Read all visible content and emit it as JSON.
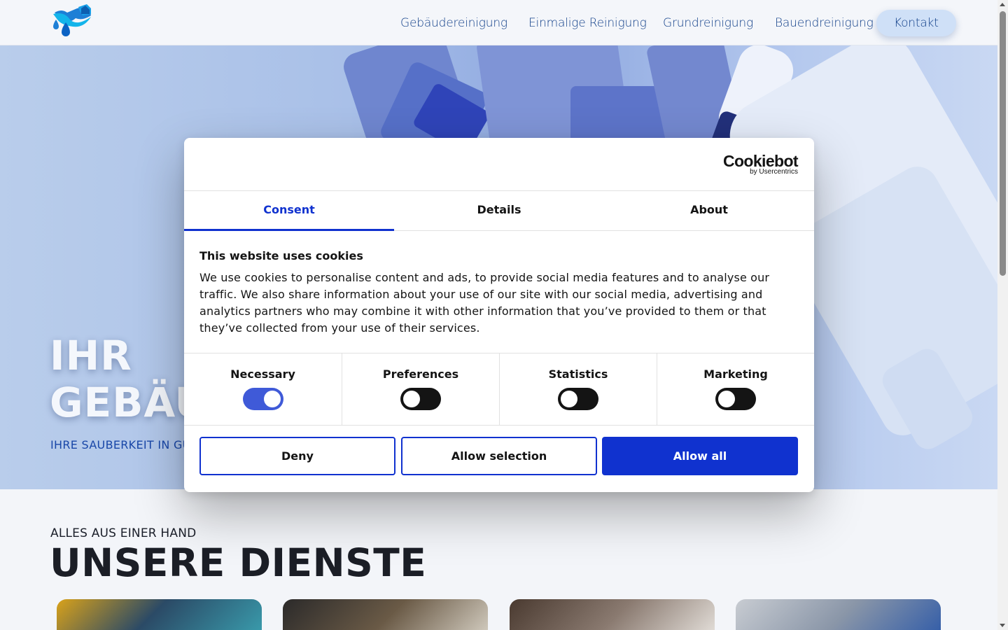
{
  "header": {
    "nav": [
      {
        "label": "Gebäudereinigung"
      },
      {
        "label": "Einmalige Reinigung"
      },
      {
        "label": "Grundreinigung"
      },
      {
        "label": "Bauendreinigung"
      },
      {
        "label": "Kontakt"
      }
    ],
    "logo_icon": "house-water-drop-logo"
  },
  "hero": {
    "title_line1": "IHR",
    "title_line2": "GEBÄU",
    "subtitle": "IHRE SAUBERKEIT IN GU"
  },
  "services": {
    "kicker": "ALLES AUS EINER HAND",
    "title": "UNSERE DIENSTE"
  },
  "cookie_dialog": {
    "brand": "Cookiebot",
    "brand_sub": "by Usercentrics",
    "tabs": [
      {
        "label": "Consent",
        "active": true
      },
      {
        "label": "Details",
        "active": false
      },
      {
        "label": "About",
        "active": false
      }
    ],
    "heading": "This website uses cookies",
    "body": "We use cookies to personalise content and ads, to provide social media features and to analyse our traffic. We also share information about your use of our site with our social media, advertising and analytics partners who may combine it with other information that you’ve provided to them or that they’ve collected from your use of their services.",
    "toggles": [
      {
        "label": "Necessary",
        "checked": true
      },
      {
        "label": "Preferences",
        "checked": false
      },
      {
        "label": "Statistics",
        "checked": false
      },
      {
        "label": "Marketing",
        "checked": false
      }
    ],
    "buttons": {
      "deny": "Deny",
      "allow_selection": "Allow selection",
      "allow_all": "Allow all"
    }
  },
  "colors": {
    "accent": "#1032cf",
    "nav_text": "#12408a",
    "kontakt_bg": "#cfe0f7"
  }
}
